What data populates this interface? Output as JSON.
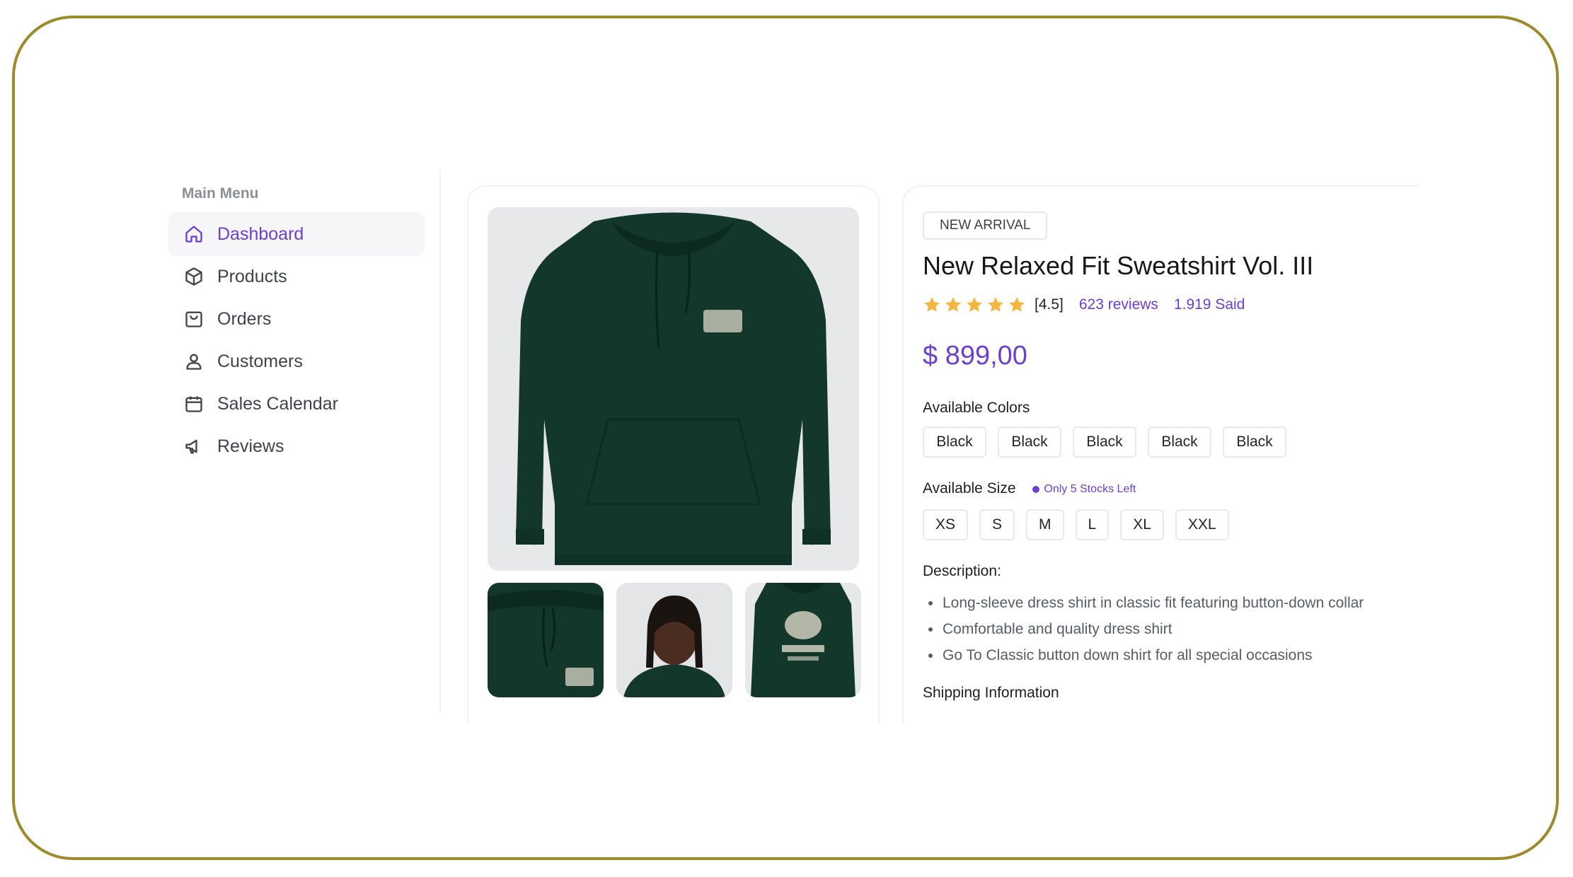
{
  "sidebar": {
    "heading": "Main Menu",
    "items": [
      {
        "label": "Dashboard",
        "icon": "home-icon",
        "active": true
      },
      {
        "label": "Products",
        "icon": "box-icon"
      },
      {
        "label": "Orders",
        "icon": "shopping-bag-icon"
      },
      {
        "label": "Customers",
        "icon": "user-icon"
      },
      {
        "label": "Sales Calendar",
        "icon": "calendar-icon"
      },
      {
        "label": "Reviews",
        "icon": "megaphone-icon"
      }
    ]
  },
  "gallery": {
    "main_image": "dark green hoodie product photo",
    "thumbnails": [
      "hoodie hood close-up",
      "model portrait",
      "hoodie back print"
    ]
  },
  "product": {
    "badge": "NEW ARRIVAL",
    "title": "New Relaxed Fit Sweatshirt Vol. III",
    "rating_value": "[4.5]",
    "rating_stars": 5,
    "reviews": "623 reviews",
    "sold": "1.919 Said",
    "price": "$ 899,00",
    "colors_label": "Available Colors",
    "colors": [
      "Black",
      "Black",
      "Black",
      "Black",
      "Black"
    ],
    "size_label": "Available Size",
    "stock_note": "Only 5 Stocks Left",
    "sizes": [
      "XS",
      "S",
      "M",
      "L",
      "XL",
      "XXL"
    ],
    "description_label": "Description:",
    "description": [
      "Long-sleeve dress shirt in classic fit featuring button-down collar",
      "Comfortable and quality dress shirt",
      "Go To Classic button down shirt for all special occasions"
    ],
    "shipping_label": "Shipping Information"
  },
  "colors": {
    "accent": "#6a3fd1",
    "star": "#f5b53f",
    "hoodie": "#14372b",
    "frame": "#9c8a2c"
  }
}
